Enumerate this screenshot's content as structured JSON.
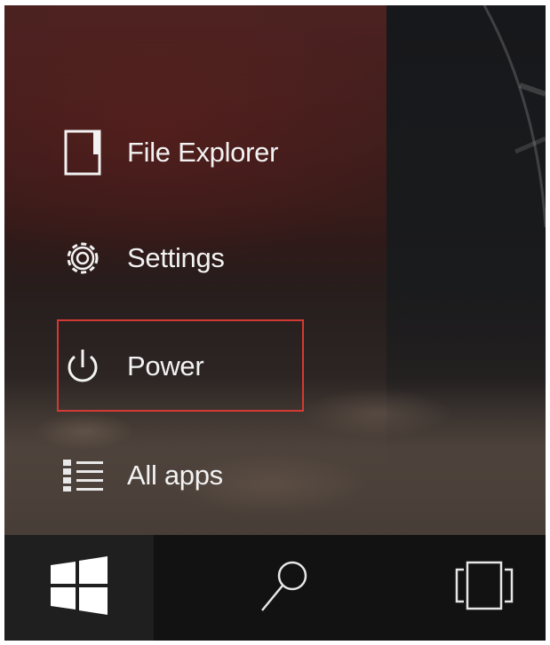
{
  "start_menu": {
    "items": [
      {
        "label": "File Explorer",
        "icon": "file-explorer-icon"
      },
      {
        "label": "Settings",
        "icon": "gear-icon"
      },
      {
        "label": "Power",
        "icon": "power-icon",
        "highlighted": true
      },
      {
        "label": "All apps",
        "icon": "list-icon"
      }
    ],
    "highlight_color": "#d33a34"
  },
  "taskbar": {
    "buttons": [
      {
        "icon": "windows-logo-icon"
      },
      {
        "icon": "search-icon"
      },
      {
        "icon": "task-view-icon"
      }
    ]
  }
}
